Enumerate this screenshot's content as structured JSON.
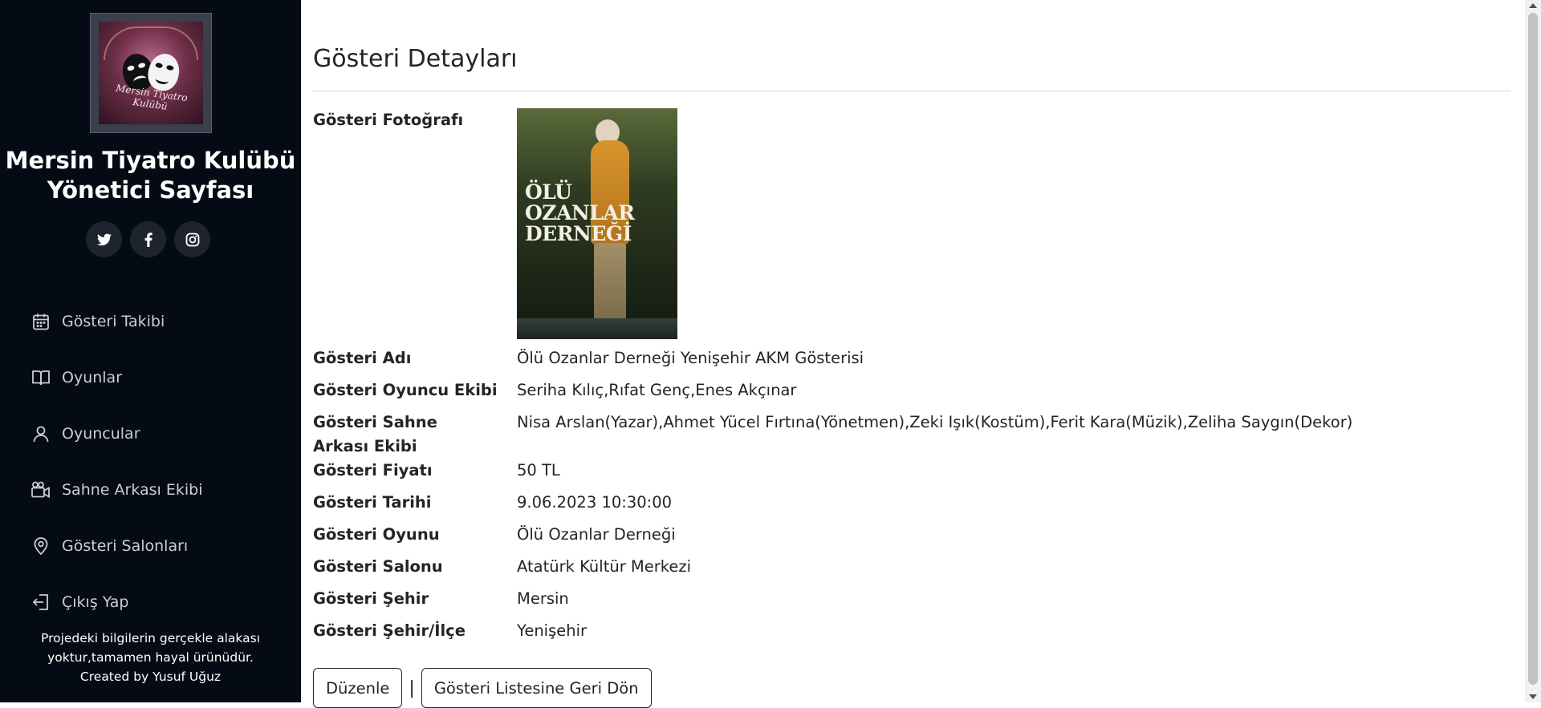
{
  "sidebar": {
    "logo_text": "Mersin Tiyatro Kulübü",
    "brand_line1": "Mersin Tiyatro Kulübü",
    "brand_line2": "Yönetici Sayfası",
    "socials": [
      {
        "icon": "twitter-icon"
      },
      {
        "icon": "facebook-icon"
      },
      {
        "icon": "instagram-icon"
      }
    ],
    "nav": [
      {
        "label": "Gösteri Takibi",
        "icon": "calendar-icon"
      },
      {
        "label": "Oyunlar",
        "icon": "book-icon"
      },
      {
        "label": "Oyuncular",
        "icon": "user-icon"
      },
      {
        "label": "Sahne Arkası Ekibi",
        "icon": "video-camera-icon"
      },
      {
        "label": "Gösteri Salonları",
        "icon": "map-pin-icon"
      },
      {
        "label": "Çıkış Yap",
        "icon": "logout-icon"
      }
    ],
    "footer_line1": "Projedeki bilgilerin gerçekle alakası",
    "footer_line2": "yoktur,tamamen hayal ürünüdür.",
    "footer_line3": "Created by Yusuf Uğuz"
  },
  "main": {
    "title": "Gösteri Detayları",
    "photo_label": "Gösteri Fotoğrafı",
    "poster_title_lines": [
      "ÖLÜ",
      "OZANLAR",
      "DERNEĞİ"
    ],
    "fields": [
      {
        "label": "Gösteri Adı",
        "value": "Ölü Ozanlar Derneği Yenişehir AKM Gösterisi"
      },
      {
        "label": "Gösteri Oyuncu Ekibi",
        "value": "Seriha Kılıç,Rıfat Genç,Enes Akçınar"
      },
      {
        "label": "Gösteri Sahne Arkası Ekibi",
        "value": "Nisa Arslan(Yazar),Ahmet Yücel Fırtına(Yönetmen),Zeki Işık(Kostüm),Ferit Kara(Müzik),Zeliha Saygın(Dekor)"
      },
      {
        "label": "Gösteri Fiyatı",
        "value": "50 TL"
      },
      {
        "label": "Gösteri Tarihi",
        "value": "9.06.2023 10:30:00"
      },
      {
        "label": "Gösteri Oyunu",
        "value": "Ölü Ozanlar Derneği"
      },
      {
        "label": "Gösteri Salonu",
        "value": "Atatürk Kültür Merkezi"
      },
      {
        "label": "Gösteri Şehir",
        "value": "Mersin"
      },
      {
        "label": "Gösteri Şehir/İlçe",
        "value": "Yenişehir"
      }
    ],
    "edit_button": "Düzenle",
    "separator": "|",
    "back_button": "Gösteri Listesine Geri Dön"
  },
  "colors": {
    "sidebar_bg": "#050b14",
    "social_bg": "#1d242e",
    "nav_text": "#c9ced6"
  }
}
